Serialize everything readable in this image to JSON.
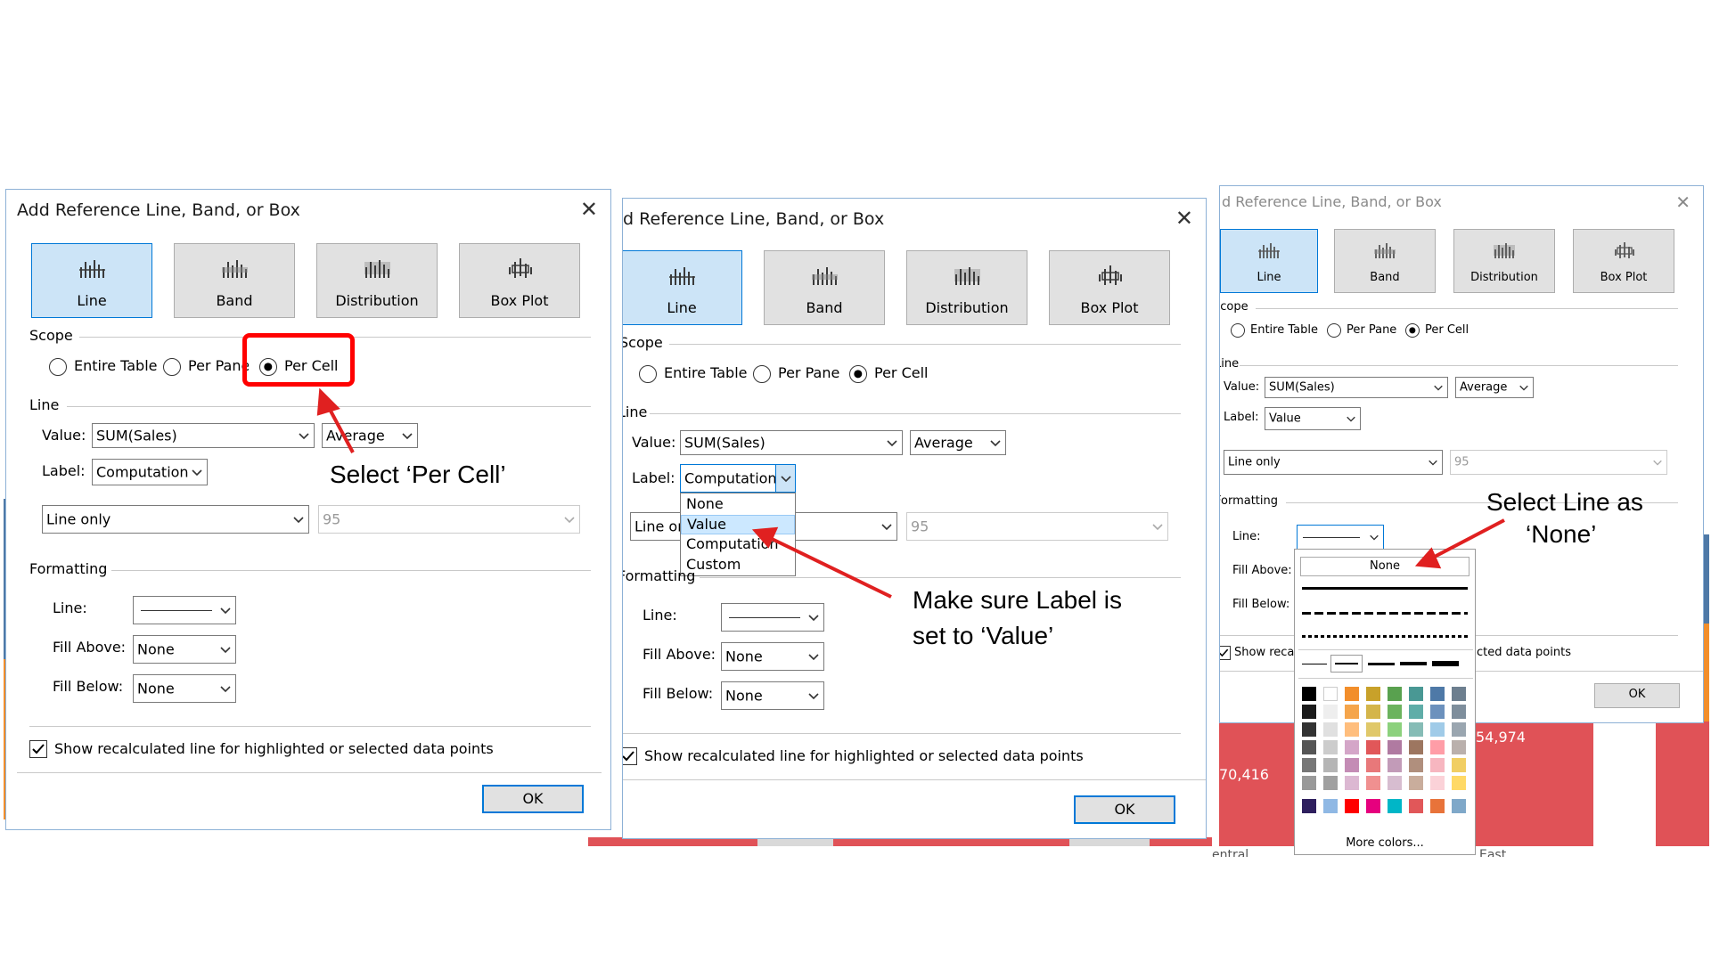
{
  "dialog1": {
    "title": "Add Reference Line, Band, or Box",
    "types": [
      "Line",
      "Band",
      "Distribution",
      "Box Plot"
    ],
    "scope_label": "Scope",
    "scope_options": [
      "Entire Table",
      "Per Pane",
      "Per Cell"
    ],
    "line_section": "Line",
    "value_label": "Value:",
    "value_field": "SUM(Sales)",
    "aggregation": "Average",
    "label_label": "Label:",
    "label_value": "Computation",
    "line_type": "Line only",
    "confidence": "95",
    "formatting_label": "Formatting",
    "line_fmt_label": "Line:",
    "fill_above_label": "Fill Above:",
    "fill_above_value": "None",
    "fill_below_label": "Fill Below:",
    "fill_below_value": "None",
    "recalc_label": "Show recalculated line for highlighted or selected data points",
    "ok_label": "OK"
  },
  "dialog2": {
    "title": "dd Reference Line, Band, or Box",
    "types": [
      "Line",
      "Band",
      "Distribution",
      "Box Plot"
    ],
    "scope_label": "Scope",
    "scope_options": [
      "Entire Table",
      "Per Pane",
      "Per Cell"
    ],
    "line_section": "Line",
    "value_label": "Value:",
    "value_field": "SUM(Sales)",
    "aggregation": "Average",
    "label_label": "Label:",
    "label_value": "Computation",
    "line_type": "Line on",
    "confidence": "95",
    "formatting_label": "Formatting",
    "line_fmt_label": "Line:",
    "fill_above_label": "Fill Above:",
    "fill_above_value": "None",
    "fill_below_label": "Fill Below:",
    "fill_below_value": "None",
    "recalc_label": "Show recalculated line for highlighted or selected data points",
    "ok_label": "OK",
    "dropdown_options": [
      "None",
      "Value",
      "Computation",
      "Custom"
    ]
  },
  "dialog3": {
    "title": "d Reference Line, Band, or Box",
    "types": [
      "Line",
      "Band",
      "Distribution",
      "Box Plot"
    ],
    "scope_label": "Scope",
    "scope_options": [
      "Entire Table",
      "Per Pane",
      "Per Cell"
    ],
    "line_section": "Line",
    "value_label": "Value:",
    "value_field": "SUM(Sales)",
    "aggregation": "Average",
    "label_label": "Label:",
    "label_value": "Value",
    "line_type": "Line only",
    "confidence": "95",
    "formatting_label": "Formatting",
    "line_fmt_label": "Line:",
    "fill_above_label": "Fill Above:",
    "fill_below_label": "Fill Below:",
    "recalc_label": "Show recal",
    "recalc_tail": "cted data points",
    "ok_label": "OK",
    "palette_none": "None",
    "more_colors": "More colors...",
    "bg_value_left": "70,416",
    "bg_value_right": "54,974",
    "bg_axis_left": "entral",
    "bg_axis_right": "East"
  },
  "annotations": {
    "per_cell": "Select ‘Per Cell’",
    "label_value_line1": "Make sure Label is",
    "label_value_line2": "set to ‘Value’",
    "line_none_line1": "Select Line as",
    "line_none_line2": "‘None’"
  },
  "colors": {
    "accent": "#0078d7",
    "highlight_box": "#ff0000",
    "arrow": "#e02020",
    "selected_button": "#cce4f7",
    "chart_red": "#e05257",
    "chart_orange": "#f28e2b",
    "chart_blue": "#4e79a7"
  },
  "palette_swatches": [
    [
      "#000000",
      "#ffffff",
      "#f28e2b",
      "#c8a12a",
      "#59a14f",
      "#499894",
      "#4e79a7",
      "#6d7f8f"
    ],
    [
      "#1b1b1b",
      "#eeeeee",
      "#f5a54b",
      "#d4b54a",
      "#6cb35e",
      "#5fada8",
      "#6c91bd",
      "#7e8e9c"
    ],
    [
      "#333333",
      "#e0e0e0",
      "#ffbe7d",
      "#e0c86a",
      "#8cd17d",
      "#86bcb6",
      "#a0cbe8",
      "#9aa6b0"
    ],
    [
      "#555555",
      "#cccccc",
      "#d4a6c8",
      "#e15759",
      "#b07aa1",
      "#9d7660",
      "#ff9da7",
      "#bab0ac"
    ],
    [
      "#777777",
      "#b5b5b5",
      "#c48cb5",
      "#e8787a",
      "#c29bb8",
      "#b08f7d",
      "#f7b6c0",
      "#f1ce63"
    ],
    [
      "#999999",
      "#a0a0a0",
      "#dcb8d2",
      "#f09090",
      "#d7bdd0",
      "#c9ad9c",
      "#fbd2d8",
      "#ffd966"
    ],
    [
      "#2e1f5e",
      "#8fb8e4",
      "#ff0000",
      "#e6007e",
      "#00b6c7",
      "#e15759",
      "#e8733a",
      "#7fa8c9"
    ]
  ]
}
